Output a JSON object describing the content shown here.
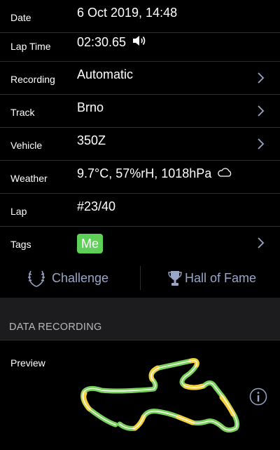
{
  "rows": [
    {
      "label": "Date",
      "value": "6 Oct 2019, 14:48"
    },
    {
      "label": "Lap Time",
      "value": "02:30.65"
    },
    {
      "label": "Recording",
      "value": "Automatic"
    },
    {
      "label": "Track",
      "value": "Brno"
    },
    {
      "label": "Vehicle",
      "value": "350Z"
    },
    {
      "label": "Weather",
      "value": "9.7°C, 57%rH, 1018hPa"
    },
    {
      "label": "Lap",
      "value": "#23/40"
    },
    {
      "label": "Tags",
      "value": "Me"
    }
  ],
  "actions": {
    "challenge": "Challenge",
    "hall_of_fame": "Hall of Fame"
  },
  "section": {
    "header": "DATA RECORDING",
    "preview_label": "Preview"
  },
  "colors": {
    "accent": "#9aa6c8",
    "tag_green": "#5ecf57",
    "track_green": "#79d35a",
    "track_yellow": "#f4d03f"
  },
  "icons": {
    "lap_time": "speaker-icon",
    "weather": "cloud-icon",
    "challenge": "laurel-icon",
    "hall_of_fame": "trophy-icon",
    "info": "info-icon",
    "disclosure": "chevron-right-icon"
  }
}
